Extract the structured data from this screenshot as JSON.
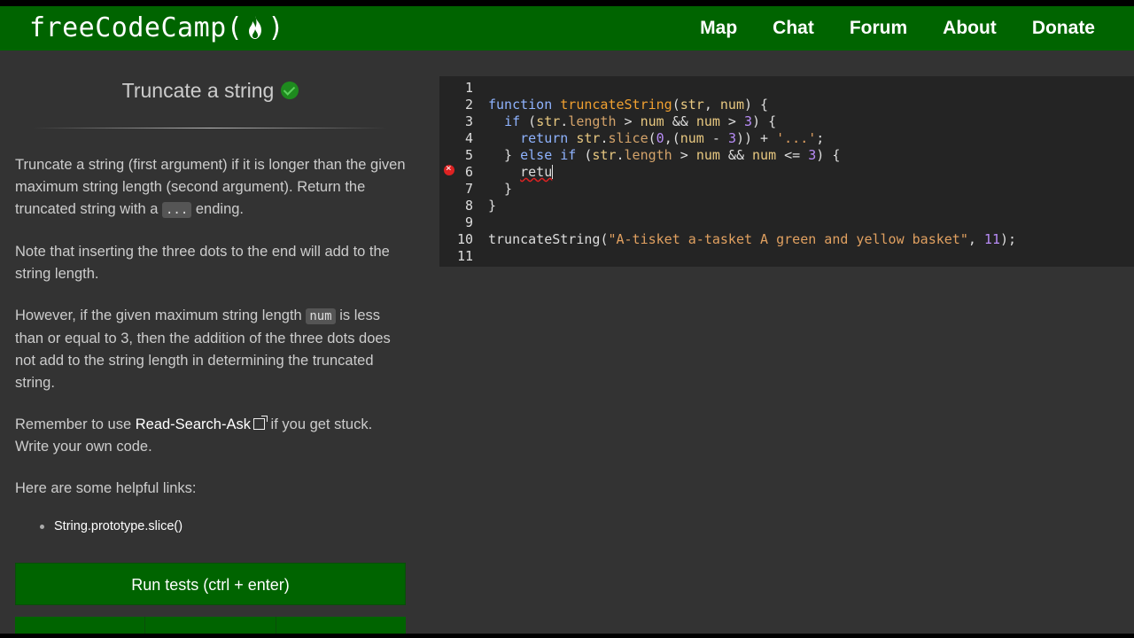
{
  "nav": {
    "brand_text_before": "freeCodeCamp(",
    "brand_text_after": ")",
    "links": [
      "Map",
      "Chat",
      "Forum",
      "About",
      "Donate"
    ]
  },
  "challenge": {
    "title": "Truncate a string",
    "p1_a": "Truncate a string (first argument) if it is longer than the given maximum string length (second argument). Return the truncated string with a ",
    "p1_code": "...",
    "p1_b": " ending.",
    "p2": "Note that inserting the three dots to the end will add to the string length.",
    "p3_a": "However, if the given maximum string length ",
    "p3_code": "num",
    "p3_b": " is less than or equal to 3, then the addition of the three dots does not add to the string length in determining the truncated string.",
    "p4_a": "Remember to use ",
    "p4_link": "Read-Search-Ask",
    "p4_b": " if you get stuck. Write your own code.",
    "p5": "Here are some helpful links:",
    "helpful_link": "String.prototype.slice()",
    "run_button": "Run tests (ctrl + enter)"
  },
  "editor": {
    "line_numbers": [
      "1",
      "2",
      "3",
      "4",
      "5",
      "6",
      "7",
      "8",
      "9",
      "10",
      "11"
    ]
  },
  "colors": {
    "accent": "#006400",
    "background": "#333333",
    "editor_bg": "#242424"
  }
}
